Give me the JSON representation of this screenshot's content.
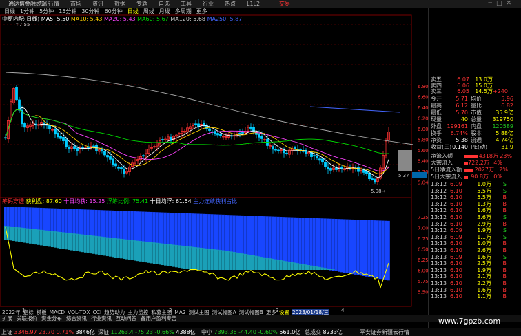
{
  "topbar": {
    "brand": "通达信金融终端",
    "menu": [
      "行情",
      "市场",
      "资讯",
      "数据",
      "专题",
      "自选",
      "工具",
      "行业",
      "热点",
      "L1L2"
    ],
    "trade": "交易"
  },
  "periods": {
    "items": [
      "日线",
      "1分钟",
      "5分钟",
      "15分钟",
      "30分钟",
      "60分钟",
      "日线",
      "周线",
      "月线",
      "多周期",
      "更多"
    ],
    "active_index": 6
  },
  "main_chart": {
    "title": "中原内配(日线)",
    "ma": [
      {
        "label": "MA5: 5.50",
        "color": "#ffffff"
      },
      {
        "label": "MA10: 5.43",
        "color": "#ffd000"
      },
      {
        "label": "MA20: 5.43",
        "color": "#ff44ff"
      },
      {
        "label": "MA60: 5.67",
        "color": "#00dd00"
      },
      {
        "label": "MA120: 5.68",
        "color": "#cccccc"
      },
      {
        "label": "MA250: 5.87",
        "color": "#4466ff"
      }
    ],
    "price_axis": [
      "6.80",
      "6.60",
      "6.40",
      "6.20",
      "6.00",
      "5.80",
      "5.60",
      "5.40",
      "5.20",
      "5.04"
    ],
    "annotations": {
      "high": "7.55",
      "low": "5.08",
      "mid": "5.37"
    }
  },
  "indicator": {
    "name": "筹码穿透",
    "items": [
      {
        "label": "获利盘",
        "value": "87.60",
        "color": "#ffff00"
      },
      {
        "label": "十日均获",
        "value": "15.25",
        "color": "#ff44ff"
      },
      {
        "label": "浮筹比例",
        "value": "75.41",
        "color": "#00dd00"
      },
      {
        "label": "十日均浮",
        "value": "61.54",
        "color": "#ffffff"
      },
      {
        "label": "主力连续获利占比",
        "value": "",
        "color": "#4466ff"
      }
    ],
    "axis": [
      "7.25",
      "7.00",
      "6.75",
      "6.50",
      "6.25",
      "6.00",
      "5.75",
      "5.50"
    ]
  },
  "right_panel": {
    "asks": [
      {
        "label": "卖五",
        "price": "6.07",
        "vol": "13.0万"
      },
      {
        "label": "卖四",
        "price": "6.06",
        "vol": "15.0万"
      },
      {
        "label": "卖三",
        "price": "6.05",
        "vol": "14.5万",
        "chg": "+240"
      }
    ],
    "stats": [
      {
        "k": "今开",
        "v": "5.71",
        "k2": "均价",
        "v2": "5.96"
      },
      {
        "k": "最高",
        "v": "6.12",
        "k2": "量比",
        "v2": "6.82"
      },
      {
        "k": "最低",
        "v": "5.70",
        "k2": "市值",
        "v2": "35.9亿"
      },
      {
        "k": "现量",
        "v": "40",
        "k2": "总量",
        "v2": "319750"
      },
      {
        "k": "外盘",
        "v": "199161",
        "k2": "内盘",
        "v2": "120589"
      },
      {
        "k": "换手",
        "v": "6.74%",
        "k2": "股本",
        "v2": "5.88亿"
      },
      {
        "k": "净资",
        "v": "5.38",
        "k2": "流通",
        "v2": "4.74亿"
      },
      {
        "k": "收益(三)",
        "v": "0.140",
        "k2": "PE(动)",
        "v2": "31.9"
      }
    ],
    "flow": [
      {
        "k": "净流入额",
        "v": "4318万",
        "p": "23%"
      },
      {
        "k": "大宗流入",
        "v": "722.2万",
        "p": "4%"
      },
      {
        "k": "5日净流入额",
        "v": "2027万",
        "p": "2%"
      },
      {
        "k": "5日大宗流入",
        "v": "90.8万",
        "p": "0%"
      }
    ],
    "ticks": [
      {
        "t": "13:12",
        "p": "6.09",
        "v": "1.0万",
        "d": "S"
      },
      {
        "t": "13:12",
        "p": "6.10",
        "v": "5.5万",
        "d": "S"
      },
      {
        "t": "13:12",
        "p": "6.10",
        "v": "5.5万",
        "d": "B"
      },
      {
        "t": "13:12",
        "p": "6.10",
        "v": "1.3万",
        "d": "B"
      },
      {
        "t": "13:12",
        "p": "6.10",
        "v": "1.6万",
        "d": "B"
      },
      {
        "t": "13:12",
        "p": "6.10",
        "v": "3.6万",
        "d": "S"
      },
      {
        "t": "13:12",
        "p": "6.10",
        "v": "2.9万",
        "d": "B"
      },
      {
        "t": "13:12",
        "p": "6.09",
        "v": "1.9万",
        "d": "S"
      },
      {
        "t": "13:13",
        "p": "6.09",
        "v": "1.1万",
        "d": "S"
      },
      {
        "t": "13:13",
        "p": "6.10",
        "v": "1.0万",
        "d": "B"
      },
      {
        "t": "13:13",
        "p": "6.10",
        "v": "2.6万",
        "d": "B"
      },
      {
        "t": "13:13",
        "p": "6.09",
        "v": "1.6万",
        "d": "S"
      },
      {
        "t": "13:13",
        "p": "6.10",
        "v": "2.5万",
        "d": "B"
      },
      {
        "t": "13:13",
        "p": "6.10",
        "v": "1.9万",
        "d": "B"
      },
      {
        "t": "13:13",
        "p": "6.10",
        "v": "2.1万",
        "d": "B"
      },
      {
        "t": "13:13",
        "p": "6.10",
        "v": "2.2万",
        "d": "B"
      },
      {
        "t": "13:13",
        "p": "6.10",
        "v": "1.6万",
        "d": "B"
      },
      {
        "t": "13:13",
        "p": "6.10",
        "v": "1.1万",
        "d": "B"
      }
    ]
  },
  "bottom_tabs": {
    "items": [
      "指标",
      "模板",
      "MACD",
      "VOL-TDX",
      "CCI",
      "趋势动力",
      "主力监控",
      "私募主图",
      "MA2",
      "测试主图",
      "测试幅图A",
      "测试幅图B",
      "更多",
      "设置"
    ],
    "date_label": "2023/01/18/三",
    "year_label": "2022年"
  },
  "func_bar": [
    "扩展",
    "关联报价",
    "资金分布",
    "综合资讯",
    "行业资讯",
    "互动问答",
    "备用户盈利专告"
  ],
  "status_bar": [
    {
      "name": "上证",
      "value": "3346.97",
      "chg": "23.70",
      "pct": "0.71%",
      "vol": "3846亿",
      "color": "red"
    },
    {
      "name": "深证",
      "value": "11263.4",
      "chg": "-75.23",
      "pct": "-0.66%",
      "vol": "4388亿",
      "color": "green"
    },
    {
      "name": "中小",
      "value": "7393.36",
      "chg": "-44.40",
      "pct": "-0.60%",
      "vol": "561.0亿",
      "color": "green"
    },
    {
      "name": "总成交",
      "value": "8233亿",
      "chg": "",
      "pct": "",
      "vol": "",
      "color": "white"
    }
  ],
  "status_tail": "平安证券新疆云行情",
  "watermark": "www.7gpzb.com"
}
